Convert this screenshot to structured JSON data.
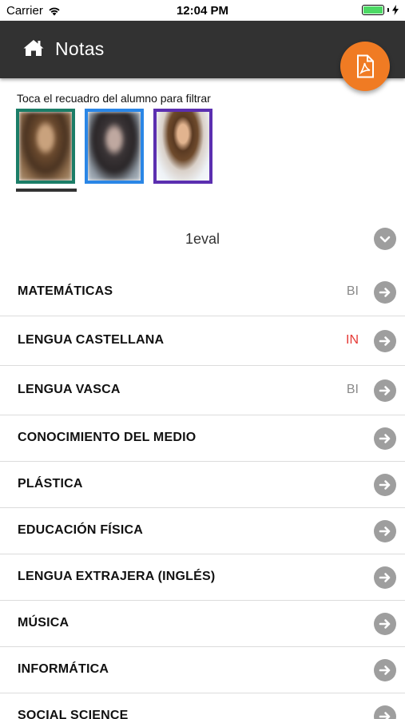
{
  "status_bar": {
    "carrier": "Carrier",
    "time": "12:04 PM",
    "battery_level": 1.0,
    "icons": [
      "wifi-icon",
      "battery-icon",
      "charging-icon"
    ]
  },
  "header": {
    "title": "Notas",
    "home_icon": "home-icon",
    "pdf_icon": "pdf-file-icon",
    "background": "#323232",
    "accent": "#f07b23"
  },
  "filter": {
    "hint": "Toca el recuadro del alumno para filtrar",
    "students": [
      {
        "frame_color": "#1b7d67",
        "selected": true
      },
      {
        "frame_color": "#2a86e6",
        "selected": false
      },
      {
        "frame_color": "#5b2fb0",
        "selected": false
      }
    ]
  },
  "evaluation": {
    "selected": "1eval",
    "icon": "chevron-down-icon"
  },
  "subjects": [
    {
      "name": "MATEMÁTICAS",
      "grade": "BI",
      "grade_color": "#8a8a8a"
    },
    {
      "name": "LENGUA CASTELLANA",
      "grade": "IN",
      "grade_color": "#e53935"
    },
    {
      "name": "LENGUA VASCA",
      "grade": "BI",
      "grade_color": "#8a8a8a"
    },
    {
      "name": "CONOCIMIENTO DEL MEDIO",
      "grade": "",
      "grade_color": "#8a8a8a"
    },
    {
      "name": "PLÁSTICA",
      "grade": "",
      "grade_color": "#8a8a8a"
    },
    {
      "name": "EDUCACIÓN FÍSICA",
      "grade": "",
      "grade_color": "#8a8a8a"
    },
    {
      "name": "LENGUA EXTRAJERA (INGLÉS)",
      "grade": "",
      "grade_color": "#8a8a8a"
    },
    {
      "name": "MÚSICA",
      "grade": "",
      "grade_color": "#8a8a8a"
    },
    {
      "name": "INFORMÁTICA",
      "grade": "",
      "grade_color": "#8a8a8a"
    },
    {
      "name": "SOCIAL SCIENCE",
      "grade": "",
      "grade_color": "#8a8a8a"
    }
  ]
}
